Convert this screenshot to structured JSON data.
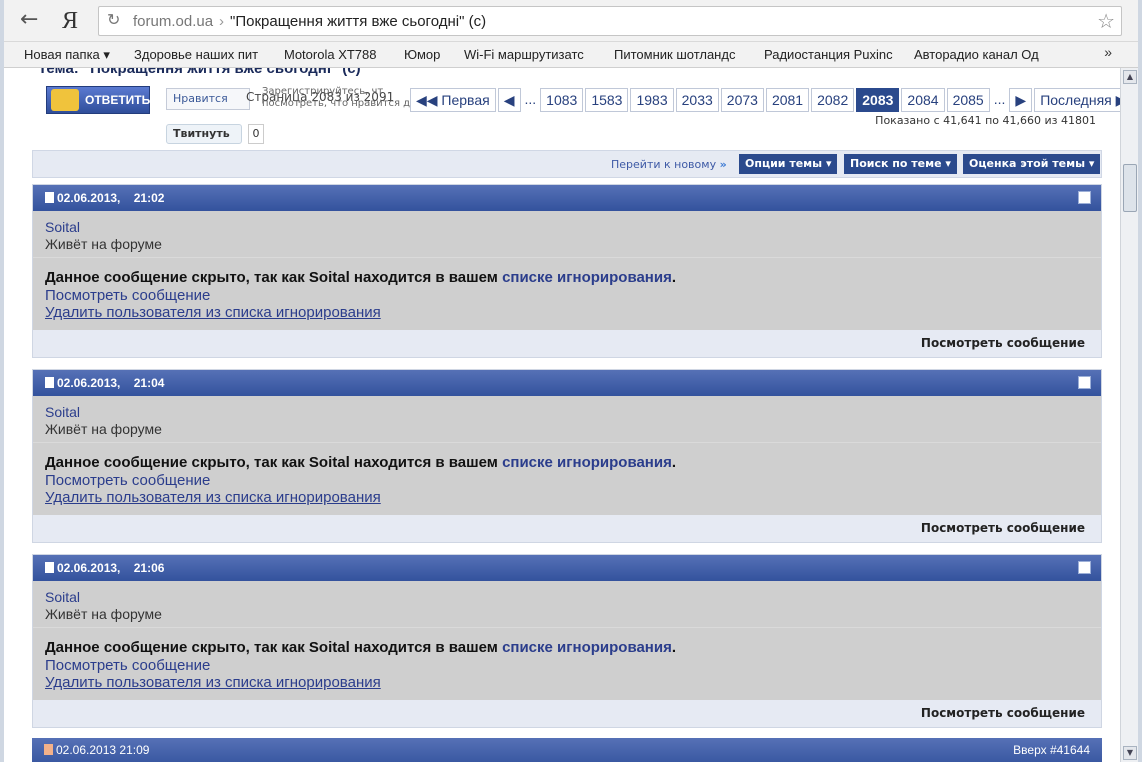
{
  "browser": {
    "back_glyph": "←",
    "logo": "Я",
    "reload_glyph": "↻",
    "url_host": "forum.od.ua",
    "url_sep": "›",
    "page_title": "\"Покращення життя вже сьогодні\" (с)",
    "star_glyph": "☆",
    "bookmarks": [
      "Новая папка ▾",
      "Здоровье наших пит",
      "Motorola XT788",
      "Юмор",
      "Wi-Fi маршрутизатс",
      "Питомник шотландс",
      "Радиостанция Puxinc",
      "Авторадио канал Од"
    ],
    "bookmarks_more": "»"
  },
  "thread": {
    "title": "Тема: \"Покращення життя вже сьогодні\" (с)",
    "reply_label": "ОТВЕТИТЬ",
    "like_label": "Нравится",
    "page_of": "Страница 2083 из 2091",
    "fb_note_1": "Зарегистрируйтесь, чт",
    "fb_note_2": "посмотреть, что нравится друзьям.",
    "tweet_label": "Твитнуть",
    "tweet_count": "0",
    "pager": {
      "first": "◀◀ Первая",
      "prev": "◀",
      "dots1": "...",
      "pages": [
        "1083",
        "1583",
        "1983",
        "2033",
        "2073",
        "2081",
        "2082",
        "2083",
        "2084",
        "2085"
      ],
      "current": "2083",
      "dots2": "...",
      "next": "▶",
      "last": "Последняя ▶▶"
    },
    "shown": "Показано с 41,641 по 41,660 из 41801"
  },
  "toolbar": {
    "go_new": "Перейти к новому",
    "options": "Опции темы ▾",
    "search": "Поиск по теме ▾",
    "rating": "Оценка этой темы ▾"
  },
  "posts": [
    {
      "date": "02.06.2013,",
      "time": "21:02",
      "user": "Soital",
      "user_title": "Живёт на форуме",
      "hidden_prefix": "Данное сообщение скрыто, так как Soital находится в вашем ",
      "ignore_link": "списке игнорирования",
      "hidden_suffix": ".",
      "view": "Посмотреть сообщение",
      "remove": "Удалить пользователя из списка игнорирования",
      "foot_view": "Посмотреть сообщение"
    },
    {
      "date": "02.06.2013,",
      "time": "21:04",
      "user": "Soital",
      "user_title": "Живёт на форуме",
      "hidden_prefix": "Данное сообщение скрыто, так как Soital находится в вашем ",
      "ignore_link": "списке игнорирования",
      "hidden_suffix": ".",
      "view": "Посмотреть сообщение",
      "remove": "Удалить пользователя из списка игнорирования",
      "foot_view": "Посмотреть сообщение"
    },
    {
      "date": "02.06.2013,",
      "time": "21:06",
      "user": "Soital",
      "user_title": "Живёт на форуме",
      "hidden_prefix": "Данное сообщение скрыто, так как Soital находится в вашем ",
      "ignore_link": "списке игнорирования",
      "hidden_suffix": ".",
      "view": "Посмотреть сообщение",
      "remove": "Удалить пользователя из списка игнорирования",
      "foot_view": "Посмотреть сообщение"
    }
  ],
  "partial_post": {
    "datetime": "02.06.2013 21:09",
    "top_link": "Вверх #41644"
  }
}
